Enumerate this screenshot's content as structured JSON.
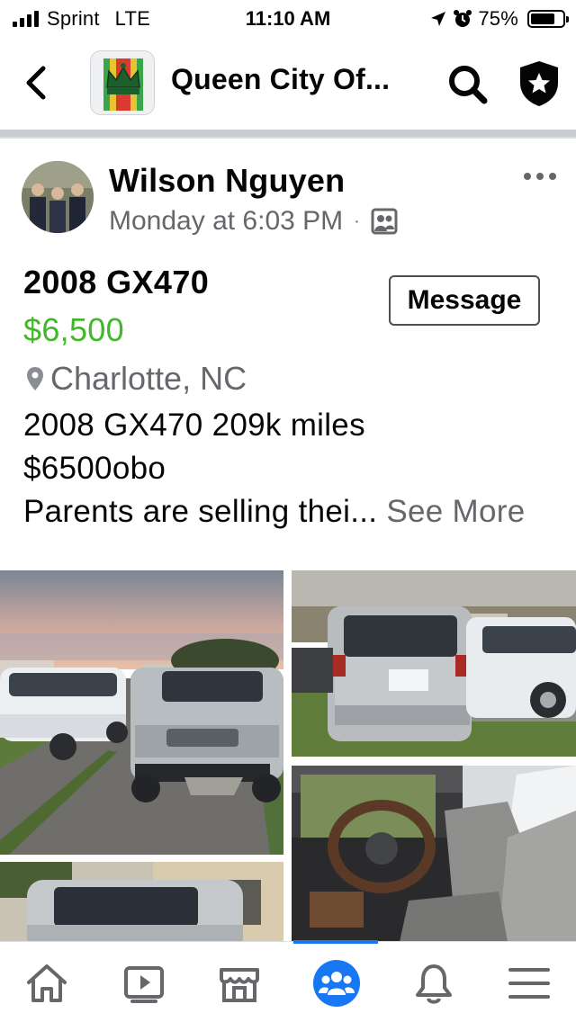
{
  "status_bar": {
    "carrier": "Sprint",
    "network": "LTE",
    "time": "11:10 AM",
    "battery_percent": "75%",
    "battery_level": 0.75,
    "signal_bars": 4,
    "icons": [
      "location-arrow-icon",
      "alarm-clock-icon",
      "battery-icon"
    ]
  },
  "header": {
    "title": "Queen City Of...",
    "back_icon": "chevron-left-icon",
    "search_icon": "search-icon",
    "admin_icon": "shield-star-icon"
  },
  "post": {
    "author": "Wilson Nguyen",
    "timestamp": "Monday at 6:03 PM",
    "separator": "·",
    "audience_icon": "group-members-icon",
    "more_icon": "more-dots-icon",
    "listing": {
      "title": "2008 GX470",
      "price": "$6,500",
      "location": "Charlotte, NC",
      "message_label": "Message"
    },
    "body_lines": [
      "2008 GX470 209k miles",
      "$6500obo",
      "Parents are selling thei..."
    ],
    "see_more": "See More"
  },
  "photos": [
    "gx470-front-view",
    "gx470-rear-view",
    "gx470-interior",
    "gx470-side-view"
  ],
  "tab_bar": {
    "active": "groups",
    "tabs": [
      "home-icon",
      "watch-icon",
      "marketplace-icon",
      "groups-icon",
      "notifications-icon",
      "menu-icon"
    ]
  },
  "colors": {
    "accent": "#1877f2",
    "price": "#42b72a",
    "secondary_text": "#65676b"
  }
}
